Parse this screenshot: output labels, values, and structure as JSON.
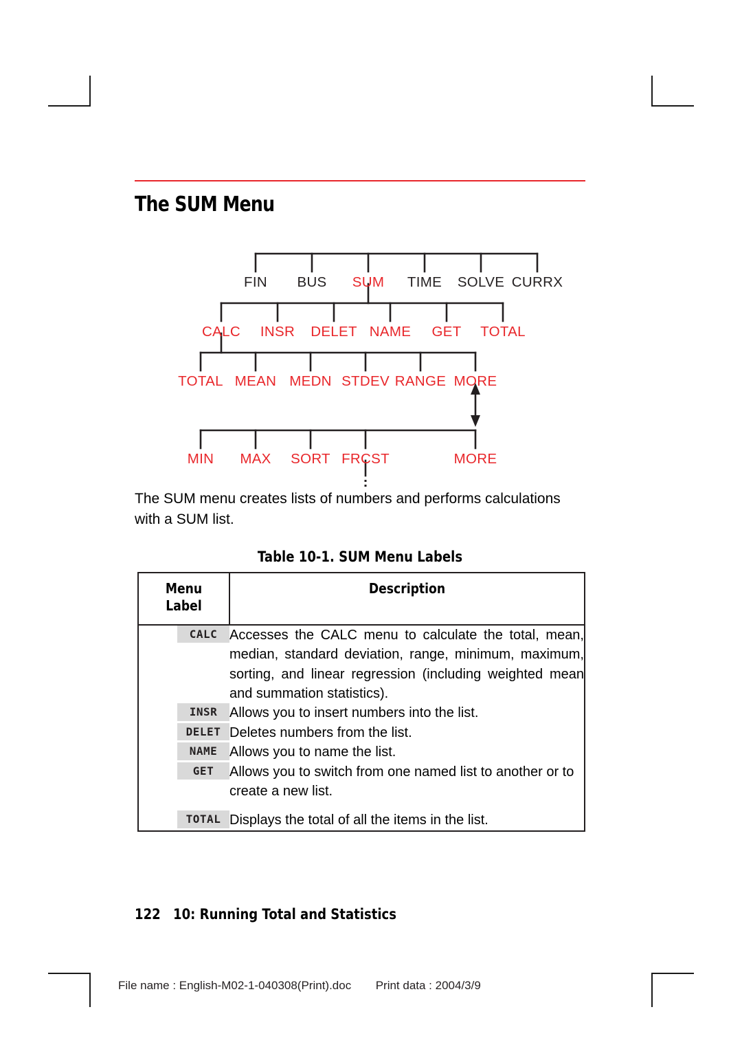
{
  "page": {
    "title": "The SUM Menu",
    "accent_rule_color": "#e8262a",
    "paragraph": "The SUM menu creates lists of numbers and performs calculations with a SUM list.",
    "footer_page_number": "122",
    "footer_chapter": "10: Running Total and Statistics",
    "print_file_label": "File name : English-M02-1-040308(Print).doc",
    "print_date_label": "Print data : 2004/3/9"
  },
  "diagram": {
    "name": "sum-menu-tree",
    "highlight_color": "#e8262a",
    "plain_color": "#231f20",
    "levels": [
      {
        "row": 1,
        "nodes": [
          {
            "label": "FIN",
            "color": "plain"
          },
          {
            "label": "BUS",
            "color": "plain"
          },
          {
            "label": "SUM",
            "color": "highlight"
          },
          {
            "label": "TIME",
            "color": "plain"
          },
          {
            "label": "SOLVE",
            "color": "plain"
          },
          {
            "label": "CURRX",
            "color": "plain"
          }
        ]
      },
      {
        "row": 2,
        "nodes": [
          {
            "label": "CALC",
            "color": "highlight"
          },
          {
            "label": "INSR",
            "color": "highlight"
          },
          {
            "label": "DELET",
            "color": "highlight"
          },
          {
            "label": "NAME",
            "color": "highlight"
          },
          {
            "label": "GET",
            "color": "highlight"
          },
          {
            "label": "TOTAL",
            "color": "highlight"
          }
        ]
      },
      {
        "row": 3,
        "nodes": [
          {
            "label": "TOTAL",
            "color": "highlight"
          },
          {
            "label": "MEAN",
            "color": "highlight"
          },
          {
            "label": "MEDN",
            "color": "highlight"
          },
          {
            "label": "STDEV",
            "color": "highlight"
          },
          {
            "label": "RANGE",
            "color": "highlight"
          },
          {
            "label": "MORE",
            "color": "highlight"
          }
        ]
      },
      {
        "row": 4,
        "nodes": [
          {
            "label": "MIN",
            "color": "highlight"
          },
          {
            "label": "MAX",
            "color": "highlight"
          },
          {
            "label": "SORT",
            "color": "highlight"
          },
          {
            "label": "FRCST",
            "color": "highlight"
          },
          {
            "label": "MORE",
            "color": "highlight"
          }
        ]
      }
    ],
    "annotations": {
      "more_toggle_arrow": "double-headed-vertical-arrow",
      "frcst_continuation": "vertical-dotted-continuation"
    }
  },
  "table": {
    "caption": "Table 10-1. SUM Menu Labels",
    "headers": {
      "label": "Menu\nLabel",
      "label_line1": "Menu",
      "label_line2": "Label",
      "description": "Description"
    },
    "rows": [
      {
        "label": "CALC",
        "description": "Accesses the CALC menu to calculate the total, mean, median, standard deviation, range, minimum, maximum, sorting, and linear regression (including weighted mean and summation statistics)."
      },
      {
        "label": "INSR",
        "description": "Allows you to insert numbers into the list."
      },
      {
        "label": "DELET",
        "description": "Deletes numbers from the list."
      },
      {
        "label": "NAME",
        "description": "Allows you to name the list."
      },
      {
        "label": "GET",
        "description": "Allows you to switch from one named list to another or to create a new list."
      },
      {
        "label": "TOTAL",
        "description": "Displays the total of all the items in the list."
      }
    ]
  }
}
